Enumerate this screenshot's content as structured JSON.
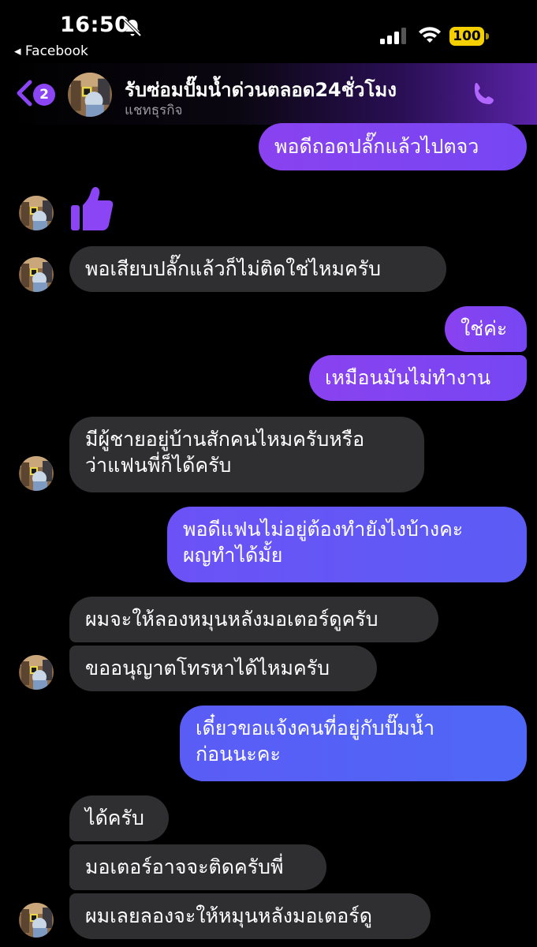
{
  "status": {
    "time": "16:50",
    "back_app": "◂ Facebook",
    "battery": "100"
  },
  "header": {
    "back_badge": "2",
    "title": "รับซ่อมปั๊มน้ำด่วนตลอด24ชั่วโมง",
    "subtitle": "แชทธุรกิจ"
  },
  "colors": {
    "accent": "#8b45f5",
    "incoming_bubble": "#2f2f31",
    "battery": "#f5d000"
  },
  "messages": [
    {
      "from": "me",
      "text": "พอดีถอดปลั๊กแล้วไปตจว"
    },
    {
      "from": "them",
      "type": "like"
    },
    {
      "from": "them",
      "text": "พอเสียบปลั๊กแล้วก็ไม่ติดใช่ไหมครับ"
    },
    {
      "from": "me",
      "text": "ใช่ค่ะ"
    },
    {
      "from": "me",
      "text": "เหมือนมันไม่ทำงาน"
    },
    {
      "from": "them",
      "lines": [
        "มีผู้ชายอยู่บ้านสักคนไหมครับหรือ",
        "ว่าแฟนพี่ก็ได้ครับ"
      ]
    },
    {
      "from": "me",
      "lines": [
        "พอดีแฟนไม่อยู่ต้องทำยังไงบ้างคะ",
        "ผญทำได้มั้ย"
      ]
    },
    {
      "from": "them",
      "text": "ผมจะให้ลองหมุนหลังมอเตอร์ดูครับ"
    },
    {
      "from": "them",
      "text": "ขออนุญาตโทรหาได้ไหมครับ"
    },
    {
      "from": "me",
      "lines": [
        "เดี๋ยวขอแจ้งคนที่อยู่กับปั๊มน้ำ",
        "ก่อนนะคะ"
      ]
    },
    {
      "from": "them",
      "text": "ได้ครับ"
    },
    {
      "from": "them",
      "text": "มอเตอร์อาจจะติดครับพี่"
    },
    {
      "from": "them",
      "text": "ผมเลยลองจะให้หมุนหลังมอเตอร์ดู"
    }
  ]
}
